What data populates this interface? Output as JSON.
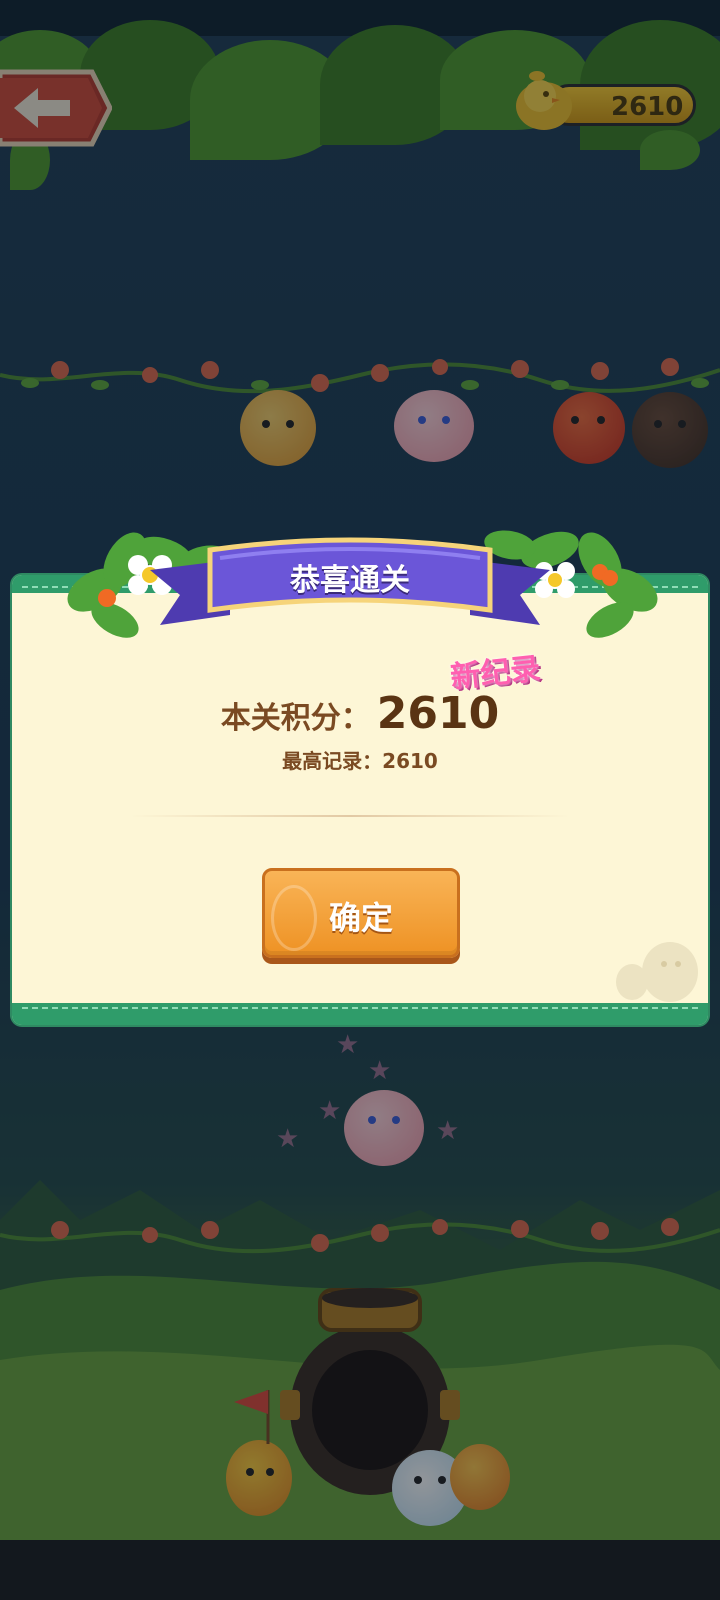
{
  "hud": {
    "coin_value": "2610"
  },
  "dialog": {
    "title": "恭喜通关",
    "new_record_badge": "新纪录",
    "score_label": "本关积分：",
    "score_value": "2610",
    "best_label": "最高记录：",
    "best_value": "2610",
    "confirm_label": "确定"
  },
  "colors": {
    "dialog_bg": "#fdf6d6",
    "dialog_border": "#2f9c6a",
    "confirm_button": "#f29a2e",
    "ribbon": "#6b56d8",
    "new_record": "#ff5fb0"
  },
  "icons": {
    "back": "arrow-left-icon",
    "coin": "chick-coin-icon"
  }
}
